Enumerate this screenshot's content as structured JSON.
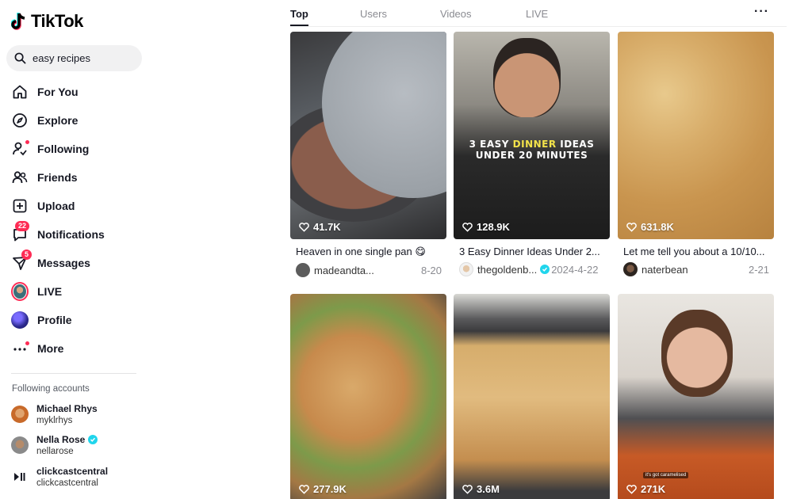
{
  "app": {
    "name": "TikTok"
  },
  "search": {
    "value": "easy recipes"
  },
  "nav": [
    {
      "label": "For You",
      "icon": "home-icon"
    },
    {
      "label": "Explore",
      "icon": "compass-icon"
    },
    {
      "label": "Following",
      "icon": "following-icon"
    },
    {
      "label": "Friends",
      "icon": "friends-icon"
    },
    {
      "label": "Upload",
      "icon": "upload-icon"
    },
    {
      "label": "Notifications",
      "icon": "notifications-icon",
      "badge": "22"
    },
    {
      "label": "Messages",
      "icon": "messages-icon",
      "badge": "5"
    },
    {
      "label": "LIVE",
      "icon": "live-avatar"
    },
    {
      "label": "Profile",
      "icon": "profile-avatar"
    },
    {
      "label": "More",
      "icon": "more-icon"
    }
  ],
  "following": {
    "title": "Following accounts",
    "accounts": [
      {
        "name": "Michael Rhys",
        "user": "myklrhys"
      },
      {
        "name": "Nella Rose",
        "user": "nellarose",
        "verified": true
      },
      {
        "name": "clickcastcentral",
        "user": "clickcastcentral"
      }
    ]
  },
  "tabs": [
    "Top",
    "Users",
    "Videos",
    "LIVE"
  ],
  "more_label": "···",
  "videos": [
    {
      "likes": "41.7K",
      "caption": "Heaven in one single pan 😋",
      "user": "madeandta...",
      "date": "8-20"
    },
    {
      "likes": "128.9K",
      "caption": "3 Easy Dinner Ideas Under 2...",
      "user": "thegoldenb...",
      "date": "2024-4-22",
      "overlay_line1_a": "3 EASY ",
      "overlay_line1_b": "DINNER",
      "overlay_line1_c": " IDEAS",
      "overlay_line2": "UNDER 20 MINUTES"
    },
    {
      "likes": "631.8K",
      "caption": "Let me tell you about a 10/10...",
      "user": "naterbean",
      "date": "2-21"
    },
    {
      "likes": "277.9K"
    },
    {
      "likes": "3.6M"
    },
    {
      "likes": "271K",
      "overlay_small": "it's got caramelised"
    }
  ],
  "colors": {
    "accent": "#fe2c55",
    "verified": "#20d5ec"
  }
}
